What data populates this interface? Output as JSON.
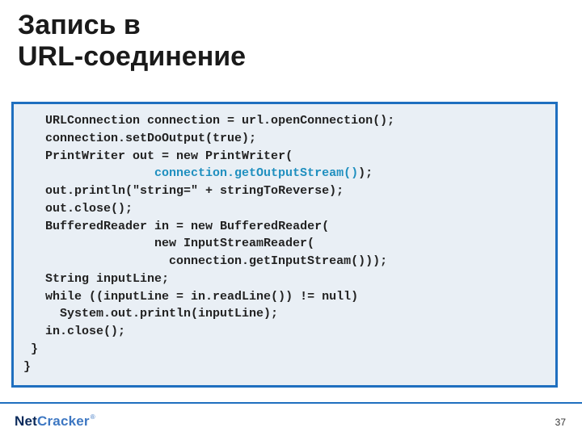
{
  "title": "Запись в\nURL-соединение",
  "code_lines": [
    {
      "indent": 3,
      "runs": [
        {
          "t": "URLConnection connection = url.openConnection();"
        }
      ]
    },
    {
      "indent": 3,
      "runs": [
        {
          "t": "connection.setDoOutput(true);"
        }
      ]
    },
    {
      "indent": 3,
      "runs": [
        {
          "t": "PrintWriter out = new PrintWriter("
        }
      ]
    },
    {
      "indent": 18,
      "runs": [
        {
          "t": "connection.getOutputStream()",
          "hl": true
        },
        {
          "t": ");"
        }
      ]
    },
    {
      "indent": 3,
      "runs": [
        {
          "t": "out.println(\"string=\" + stringToReverse);"
        }
      ]
    },
    {
      "indent": 3,
      "runs": [
        {
          "t": "out.close();"
        }
      ]
    },
    {
      "indent": 3,
      "runs": [
        {
          "t": "BufferedReader in = new BufferedReader("
        }
      ]
    },
    {
      "indent": 18,
      "runs": [
        {
          "t": "new InputStreamReader("
        }
      ]
    },
    {
      "indent": 20,
      "runs": [
        {
          "t": "connection.getInputStream()));"
        }
      ]
    },
    {
      "indent": 3,
      "runs": [
        {
          "t": "String inputLine;"
        }
      ]
    },
    {
      "indent": 3,
      "runs": [
        {
          "t": "while ((inputLine = in.readLine()) != null)"
        }
      ]
    },
    {
      "indent": 5,
      "runs": [
        {
          "t": "System.out.println(inputLine);"
        }
      ]
    },
    {
      "indent": 3,
      "runs": [
        {
          "t": "in.close();"
        }
      ]
    },
    {
      "indent": 1,
      "runs": [
        {
          "t": "}"
        }
      ]
    },
    {
      "indent": 0,
      "runs": [
        {
          "t": "}"
        }
      ]
    }
  ],
  "logo": {
    "part1": "Net",
    "part2": "Cracker",
    "reg": "®"
  },
  "page_number": "37"
}
